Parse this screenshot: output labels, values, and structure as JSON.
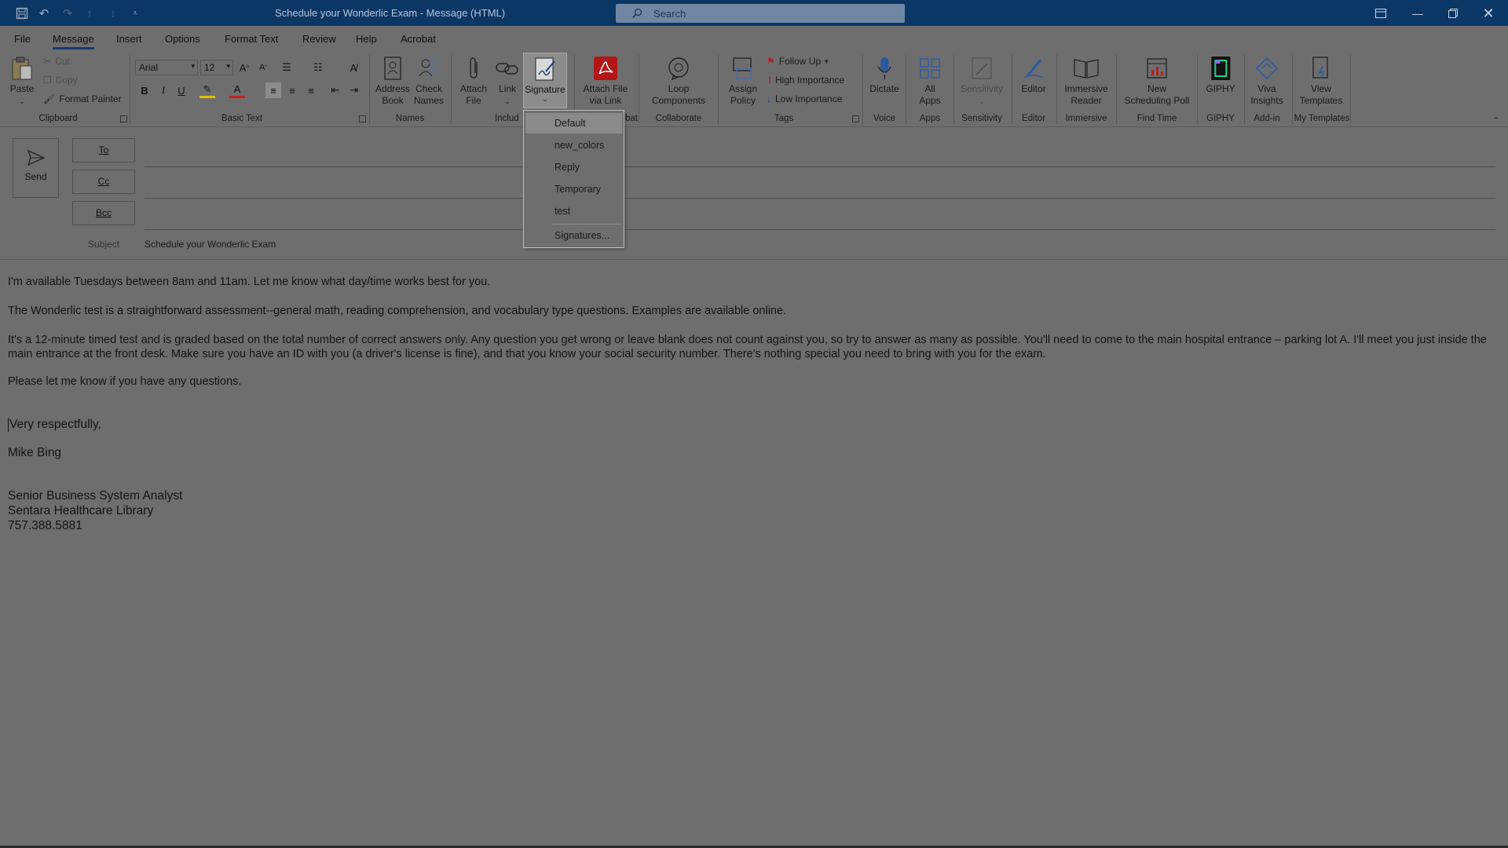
{
  "window": {
    "title": "Schedule your Wonderlic Exam  -  Message (HTML)",
    "search_placeholder": "Search"
  },
  "tabs": [
    "File",
    "Message",
    "Insert",
    "Options",
    "Format Text",
    "Review",
    "Help",
    "Acrobat"
  ],
  "active_tab": "Message",
  "ribbon": {
    "clipboard": {
      "paste": "Paste",
      "cut": "Cut",
      "copy": "Copy",
      "format_painter": "Format Painter",
      "label": "Clipboard"
    },
    "basic_text": {
      "font": "Arial",
      "size": "12",
      "label": "Basic Text"
    },
    "names": {
      "address_book": "Address Book",
      "check_names": "Check Names",
      "label": "Names"
    },
    "include": {
      "attach_file": "Attach File",
      "link": "Link",
      "signature": "Signature",
      "label": "Includ"
    },
    "acrobat": {
      "attach_via_link": "Attach File via Link",
      "label": "bat"
    },
    "collaborate": {
      "loop": "Loop Components",
      "label": "Collaborate"
    },
    "tags": {
      "assign_policy": "Assign Policy",
      "follow_up": "Follow Up",
      "high": "High Importance",
      "low": "Low Importance",
      "label": "Tags"
    },
    "voice": {
      "dictate": "Dictate",
      "label": "Voice"
    },
    "apps": {
      "all_apps": "All Apps",
      "label": "Apps"
    },
    "sensitivity": {
      "btn": "Sensitivity",
      "label": "Sensitivity"
    },
    "editor": {
      "btn": "Editor",
      "label": "Editor"
    },
    "immersive": {
      "btn": "Immersive Reader",
      "label": "Immersive"
    },
    "find_time": {
      "btn": "New Scheduling Poll",
      "label": "Find Time"
    },
    "giphy": {
      "btn": "GIPHY",
      "label": "GIPHY"
    },
    "addin": {
      "btn": "Viva Insights",
      "label": "Add-in"
    },
    "templates": {
      "btn": "View Templates",
      "label": "My Templates"
    }
  },
  "compose": {
    "send": "Send",
    "to": "To",
    "cc": "Cc",
    "bcc": "Bcc",
    "subject_label": "Subject",
    "subject": "Schedule your Wonderlic Exam"
  },
  "body": {
    "p1": "I'm available Tuesdays between 8am and 11am. Let me know what day/time works best for you.",
    "p2": "The Wonderlic test is a straightforward assessment--general math, reading comprehension, and vocabulary type questions. Examples are available online.",
    "p3": "It's a 12-minute timed test and is graded based on the total number of correct answers only. Any question you get wrong or leave blank does not count against you, so try to answer as many as possible. You'll need to come to the main hospital entrance – parking lot A. I'll meet you just inside the main entrance at the front desk. Make sure you have an ID with you (a driver's license is fine), and that you know your social security number. There's nothing special you need to bring with you for the exam.",
    "p4": "Please let me know if you have any questions.",
    "closing": "Very respectfully,",
    "name": "Mike Bing",
    "sig_title": "Senior Business System Analyst",
    "sig_org": "Sentara Healthcare Library",
    "sig_phone": "757.388.5881"
  },
  "signature_menu": {
    "items": [
      "Default",
      "new_colors",
      "Reply",
      "Temporary",
      "test"
    ],
    "highlighted": "Default",
    "manage": "Signatures..."
  }
}
